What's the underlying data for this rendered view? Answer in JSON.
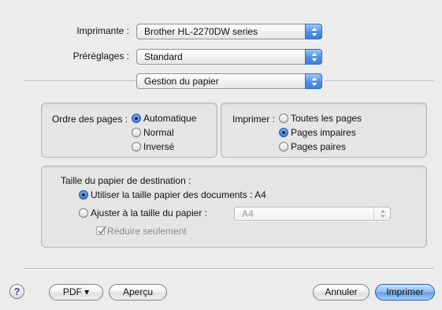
{
  "printer": {
    "label": "Imprimante :",
    "value": "Brother HL-2270DW series"
  },
  "presets": {
    "label": "Préréglages :",
    "value": "Standard"
  },
  "section": {
    "value": "Gestion du papier"
  },
  "page_order": {
    "label": "Ordre des pages :",
    "options": [
      "Automatique",
      "Normal",
      "Inversé"
    ],
    "selected": "Automatique"
  },
  "print_pages": {
    "label": "Imprimer :",
    "options": [
      "Toutes les pages",
      "Pages impaires",
      "Pages paires"
    ],
    "selected": "Pages impaires"
  },
  "destination": {
    "title": "Taille du papier de destination :",
    "use_doc_size": "Utiliser la taille papier des documents : A4",
    "fit_to_size": "Ajuster à la taille du papier :",
    "fit_size_value": "A4",
    "reduce_only": "Réduire seulement",
    "selected": "use_doc_size",
    "reduce_only_checked": true
  },
  "footer": {
    "help": "?",
    "pdf_label": "PDF ▾",
    "preview_label": "Aperçu",
    "cancel_label": "Annuler",
    "print_label": "Imprimer"
  },
  "colors": {
    "accent": "#3f7fd7",
    "background": "#ececec"
  }
}
